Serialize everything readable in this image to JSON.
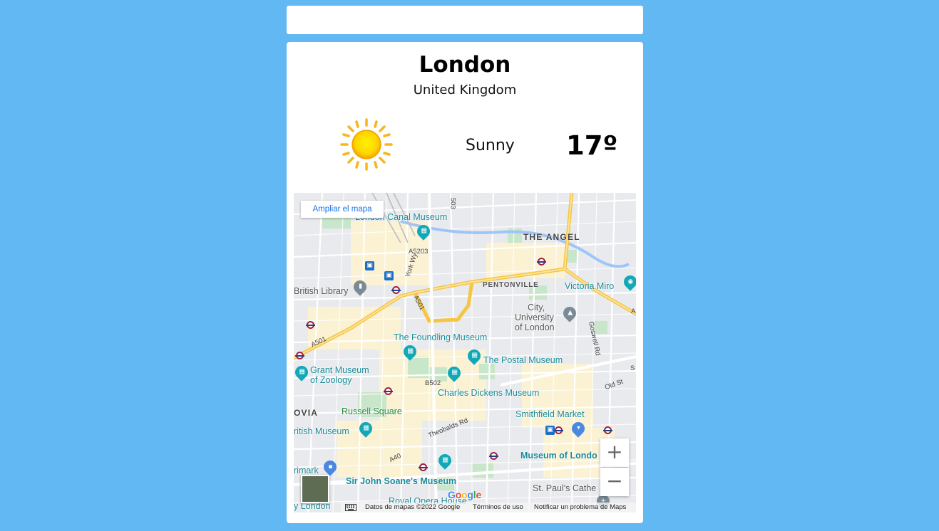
{
  "search": {
    "value": ""
  },
  "location": {
    "city": "London",
    "country": "United Kingdom"
  },
  "weather": {
    "condition": "Sunny",
    "temperature": "17º",
    "icon": "sun-icon"
  },
  "map": {
    "enlarge_label": "Ampliar el mapa",
    "zoom_in": "+",
    "zoom_out": "−",
    "attribution": {
      "data": "Datos de mapas ©2022 Google",
      "terms": "Términos de uso",
      "report": "Notificar un problema de Maps"
    },
    "google_logo": [
      "G",
      "o",
      "o",
      "g",
      "l",
      "e"
    ],
    "labels": {
      "canal_museum": "London Canal Museum",
      "the_angel": "THE ANGEL",
      "pentonville": "PENTONVILLE",
      "victoria_miro": "Victoria Miro",
      "british_library": "British Library",
      "city_university_1": "City,",
      "city_university_2": "University",
      "city_university_3": "of London",
      "foundling": "The Foundling Museum",
      "postal": "The Postal Museum",
      "grant_1": "Grant Museum",
      "grant_2": "of Zoology",
      "dickens": "Charles Dickens Museum",
      "russell": "Russell Square",
      "smithfield": "Smithfield Market",
      "british_museum": "ritish Museum",
      "museum_london": "Museum of Londo",
      "primark": "rimark",
      "soane": "Sir John Soane's Museum",
      "st_pauls": "St. Paul's Cathe",
      "royal_opera": "Royal Opera House",
      "london_partial": "y London",
      "bloomsbury_partial": "OVIA",
      "a5203": "A5203",
      "york_way": "York Wy",
      "a501_1": "A501",
      "a501_2": "A501",
      "goswell": "Goswell Rd",
      "b502": "B502",
      "theobalds": "Theobalds Rd",
      "a40": "A40",
      "old_st": "Old St",
      "a503": "503",
      "a1_partial": "A",
      "st_partial": "S"
    }
  }
}
